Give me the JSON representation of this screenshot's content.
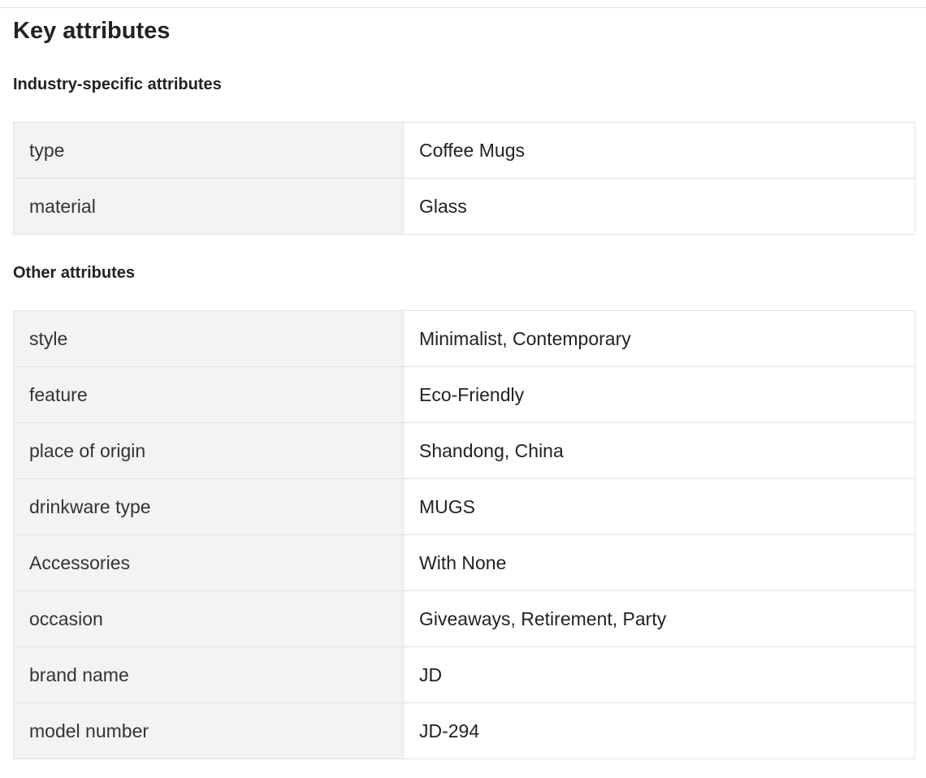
{
  "page": {
    "title": "Key attributes"
  },
  "industry": {
    "title": "Industry-specific attributes",
    "rows": [
      {
        "key": "type",
        "value": "Coffee Mugs"
      },
      {
        "key": "material",
        "value": "Glass"
      }
    ]
  },
  "other": {
    "title": "Other attributes",
    "rows": [
      {
        "key": "style",
        "value": "Minimalist, Contemporary"
      },
      {
        "key": "feature",
        "value": "Eco-Friendly"
      },
      {
        "key": "place of origin",
        "value": "Shandong, China"
      },
      {
        "key": "drinkware type",
        "value": "MUGS"
      },
      {
        "key": "Accessories",
        "value": "With None"
      },
      {
        "key": "occasion",
        "value": "Giveaways, Retirement, Party"
      },
      {
        "key": "brand name",
        "value": "JD"
      },
      {
        "key": "model number",
        "value": "JD-294"
      }
    ]
  },
  "colors": {
    "key_cell_bg": "#f3f3f3",
    "border": "#e2e2e2",
    "text": "#222222"
  }
}
